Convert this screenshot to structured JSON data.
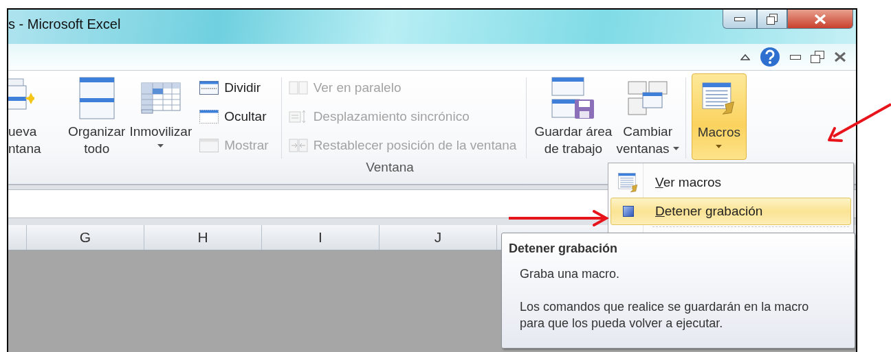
{
  "window": {
    "title": "s - Microsoft Excel"
  },
  "ribbon": {
    "large_left": [
      {
        "lines": [
          "ueva",
          "ntana"
        ],
        "dropdown": false
      },
      {
        "lines": [
          "Organizar",
          "todo"
        ],
        "dropdown": false
      },
      {
        "lines": [
          "Inmovilizar"
        ],
        "dropdown": true
      }
    ],
    "small_columns": [
      [
        {
          "label": "Dividir",
          "disabled": false
        },
        {
          "label": "Ocultar",
          "disabled": false
        },
        {
          "label": "Mostrar",
          "disabled": true
        }
      ],
      [
        {
          "label": "Ver en paralelo",
          "disabled": true
        },
        {
          "label": "Desplazamiento sincrónico",
          "disabled": true
        },
        {
          "label": "Restablecer posición de la ventana",
          "disabled": true
        }
      ]
    ],
    "large_right": [
      {
        "lines": [
          "Guardar área",
          "de trabajo"
        ],
        "dropdown": false
      },
      {
        "lines": [
          "Cambiar",
          "ventanas"
        ],
        "dropdown": true
      }
    ],
    "macros_button": {
      "lines": [
        "Macros"
      ],
      "dropdown": true,
      "selected": true
    },
    "group_label": "Ventana"
  },
  "columns": [
    "G",
    "H",
    "I",
    "J"
  ],
  "menu": [
    {
      "label": "Ver macros",
      "selected": false
    },
    {
      "label": "Detener grabación",
      "selected": true
    }
  ],
  "tooltip": {
    "title": "Detener grabación",
    "lines": [
      "Graba una macro.",
      "Los comandos que realice se guardarán en la macro para que los pueda volver a ejecutar."
    ]
  }
}
